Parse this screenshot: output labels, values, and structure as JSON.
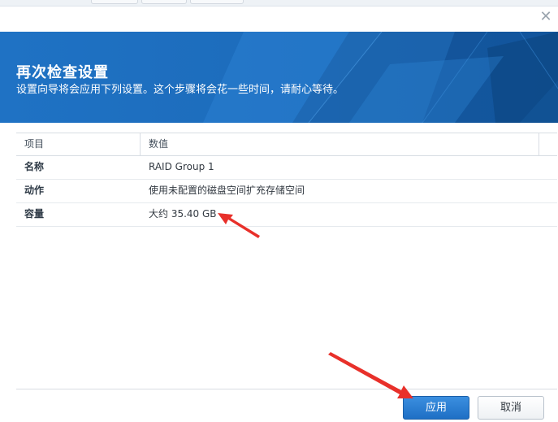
{
  "dialog": {
    "title": "再次检查设置",
    "subtitle": "设置向导将会应用下列设置。这个步骤将会花一些时间，请耐心等待。",
    "close_icon": "close-icon",
    "close_glyph": "✕"
  },
  "table": {
    "columns": [
      "项目",
      "数值"
    ],
    "rows": [
      {
        "item": "名称",
        "value": "RAID Group 1"
      },
      {
        "item": "动作",
        "value": "使用未配置的磁盘空间扩充存储空间"
      },
      {
        "item": "容量",
        "value": "大约 35.40 GB"
      }
    ]
  },
  "buttons": {
    "apply": "应用",
    "cancel": "取消"
  },
  "colors": {
    "header_blue": "#1f6fc0",
    "apply_blue": "#2a7fd6",
    "annotation_red": "#e8302a"
  }
}
